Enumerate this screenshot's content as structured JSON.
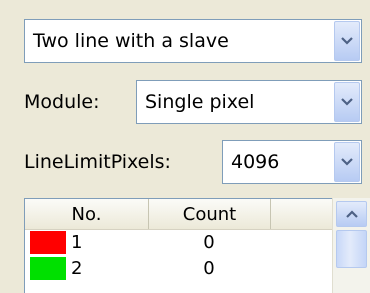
{
  "mode_select": {
    "value": "Two line with a slave"
  },
  "module": {
    "label": "Module:",
    "value": "Single pixel"
  },
  "line_limit": {
    "label": "LineLimitPixels:",
    "value": "4096"
  },
  "table": {
    "columns": [
      "No.",
      "Count"
    ],
    "rows": [
      {
        "no": "1",
        "count": "0",
        "color": "#ff0000"
      },
      {
        "no": "2",
        "count": "0",
        "color": "#00e000"
      }
    ]
  },
  "icons": {
    "dropdown": "chevron-down-icon",
    "scroll_up": "chevron-up-icon"
  }
}
